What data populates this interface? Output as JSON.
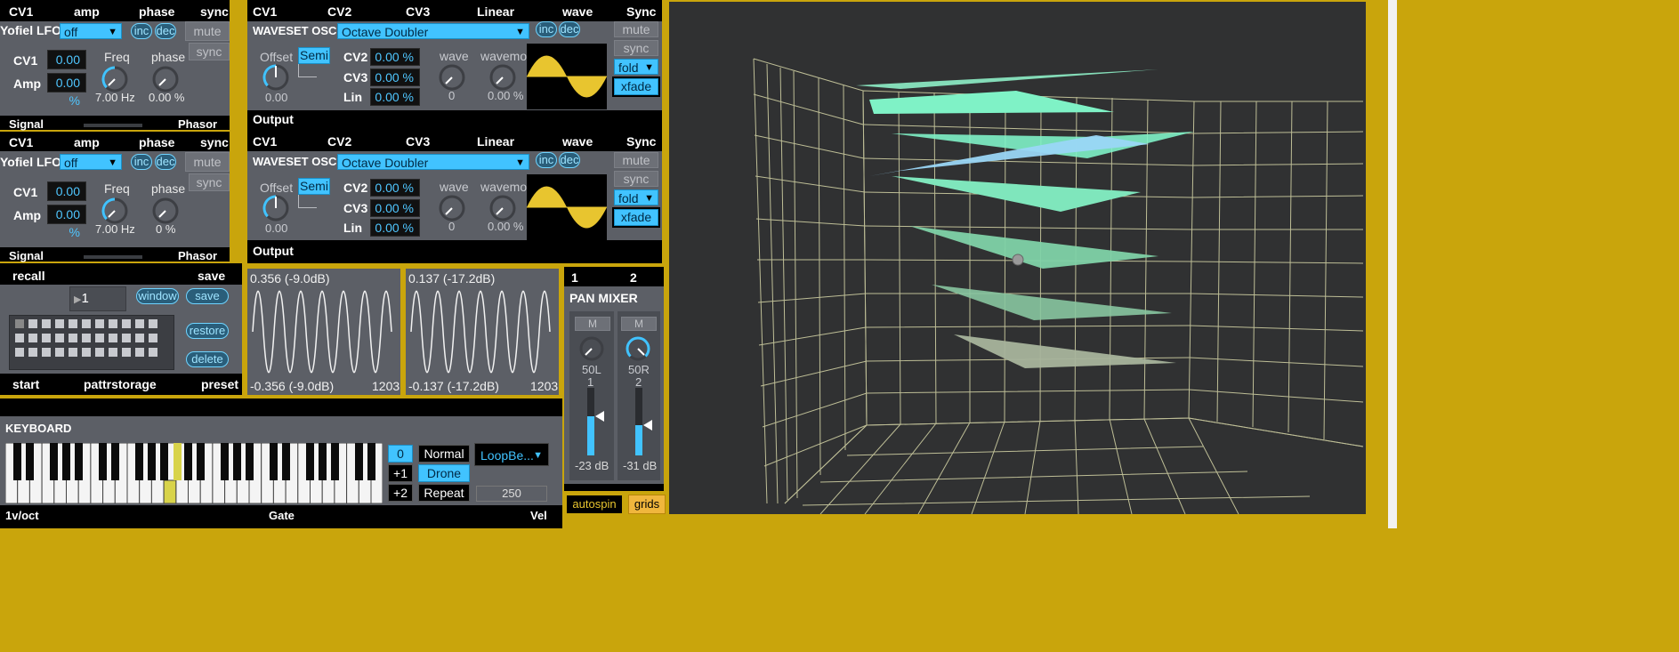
{
  "lfo1": {
    "header": [
      "CV1",
      "amp",
      "phase",
      "sync"
    ],
    "name": "Yofiel LFO",
    "mode": "off",
    "inc": "inc",
    "dec": "dec",
    "mute": "mute",
    "sync_btn": "sync",
    "cv1_label": "CV1",
    "cv1_value": "0.00 %",
    "amp_label": "Amp",
    "amp_value": "0.00 %",
    "freq_label": "Freq",
    "freq_value": "7.00 Hz",
    "phase_label": "phase",
    "phase_value": "0.00 %",
    "footer_left": "Signal",
    "footer_right": "Phasor"
  },
  "lfo2": {
    "header": [
      "CV1",
      "amp",
      "phase",
      "sync"
    ],
    "name": "Yofiel LFO",
    "mode": "off",
    "inc": "inc",
    "dec": "dec",
    "mute": "mute",
    "sync_btn": "sync",
    "cv1_label": "CV1",
    "cv1_value": "0.00 %",
    "amp_label": "Amp",
    "amp_value": "0.00 %",
    "freq_label": "Freq",
    "freq_value": "7.00 Hz",
    "phase_label": "phase",
    "phase_value": "0 %",
    "footer_left": "Signal",
    "footer_right": "Phasor"
  },
  "osc1": {
    "header": [
      "CV1",
      "CV2",
      "CV3",
      "Linear",
      "wave",
      "Sync"
    ],
    "title": "WAVESET OSC",
    "preset": "Octave Doubler",
    "inc": "inc",
    "dec": "dec",
    "mute": "mute",
    "sync_btn": "sync",
    "offset_label": "Offset",
    "offset_value": "0.00",
    "semi": "Semi",
    "cv2_label": "CV2",
    "cv2_value": "0.00 %",
    "cv3_label": "CV3",
    "cv3_value": "0.00 %",
    "lin_label": "Lin",
    "lin_value": "0.00 %",
    "wave_label": "wave",
    "wave_value": "0",
    "wavemod_label": "wavemod",
    "wavemod_value": "0.00 %",
    "fold": "fold",
    "xfade": "xfade",
    "footer": "Output"
  },
  "osc2": {
    "header": [
      "CV1",
      "CV2",
      "CV3",
      "Linear",
      "wave",
      "Sync"
    ],
    "title": "WAVESET OSC",
    "preset": "Octave Doubler",
    "inc": "inc",
    "dec": "dec",
    "mute": "mute",
    "sync_btn": "sync",
    "offset_label": "Offset",
    "offset_value": "0.00",
    "semi": "Semi",
    "cv2_label": "CV2",
    "cv2_value": "0.00 %",
    "cv3_label": "CV3",
    "cv3_value": "0.00 %",
    "lin_label": "Lin",
    "lin_value": "0.00 %",
    "wave_label": "wave",
    "wave_value": "0",
    "wavemod_label": "wavemod",
    "wavemod_value": "0.00 %",
    "fold": "fold",
    "xfade": "xfade",
    "footer": "Output"
  },
  "pattr": {
    "recall": "recall",
    "save_top": "save",
    "slot": "1",
    "window": "window",
    "save": "save",
    "restore": "restore",
    "delete": "delete",
    "start": "start",
    "name": "pattrstorage",
    "preset": "preset"
  },
  "scope1": {
    "top": "0.356 (-9.0dB)",
    "bottom": "-0.356 (-9.0dB)",
    "count": "1203"
  },
  "scope2": {
    "top": "0.137 (-17.2dB)",
    "bottom": "-0.137 (-17.2dB)",
    "count": "1203"
  },
  "mixer": {
    "ch_labels": [
      "1",
      "2"
    ],
    "title": "PAN MIXER",
    "m1": "M",
    "m2": "M",
    "pan1": "50L",
    "pan2": "50R",
    "n1": "1",
    "n2": "2",
    "db1": "-23 dB",
    "db2": "-31 dB",
    "autospin": "autospin",
    "grids": "grids"
  },
  "keyboard": {
    "title": "KEYBOARD",
    "oct0": "0",
    "oct1": "+1",
    "oct2": "+2",
    "normal": "Normal",
    "drone": "Drone",
    "repeat": "Repeat",
    "port": "LoopBe...",
    "vel_value": "250",
    "footer_left": "1v/oct",
    "footer_mid": "Gate",
    "footer_right": "Vel"
  },
  "colors": {
    "accent": "#41c3ff",
    "frame": "#c9a50c",
    "panel": "#5c5f66",
    "wave": "#e8c52f"
  }
}
